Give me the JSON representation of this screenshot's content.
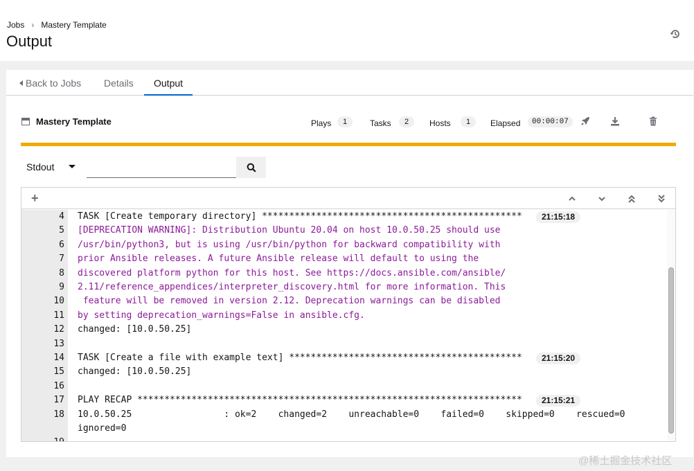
{
  "breadcrumb": {
    "jobs": "Jobs",
    "template": "Mastery Template"
  },
  "page": {
    "title": "Output"
  },
  "tabs": {
    "back": "Back to Jobs",
    "details": "Details",
    "output": "Output"
  },
  "job": {
    "name": "Mastery Template",
    "plays_label": "Plays",
    "plays": "1",
    "tasks_label": "Tasks",
    "tasks": "2",
    "hosts_label": "Hosts",
    "hosts": "1",
    "elapsed_label": "Elapsed",
    "elapsed": "00:00:07"
  },
  "search": {
    "filter_value": "Stdout",
    "placeholder": ""
  },
  "colors": {
    "progress": "#f0ab00",
    "warning_text": "#8c1a9a",
    "active_tab": "#0066cc"
  },
  "icons": [
    "history-icon",
    "rocket-icon",
    "download-icon",
    "trash-icon",
    "search-icon",
    "plus-icon",
    "chevron-up-icon",
    "chevron-down-icon",
    "double-chevron-up-icon",
    "double-chevron-down-icon"
  ],
  "output": {
    "lines": [
      {
        "num": "4",
        "text": "TASK [Create temporary directory] ************************************************",
        "warn": false,
        "ts": "21:15:18"
      },
      {
        "num": "5",
        "text": "[DEPRECATION WARNING]: Distribution Ubuntu 20.04 on host 10.0.50.25 should use",
        "warn": true,
        "ts": ""
      },
      {
        "num": "6",
        "text": "/usr/bin/python3, but is using /usr/bin/python for backward compatibility with",
        "warn": true,
        "ts": ""
      },
      {
        "num": "7",
        "text": "prior Ansible releases. A future Ansible release will default to using the",
        "warn": true,
        "ts": ""
      },
      {
        "num": "8",
        "text": "discovered platform python for this host. See https://docs.ansible.com/ansible/",
        "warn": true,
        "ts": ""
      },
      {
        "num": "9",
        "text": "2.11/reference_appendices/interpreter_discovery.html for more information. This",
        "warn": true,
        "ts": ""
      },
      {
        "num": "10",
        "text": " feature will be removed in version 2.12. Deprecation warnings can be disabled",
        "warn": true,
        "ts": ""
      },
      {
        "num": "11",
        "text": "by setting deprecation_warnings=False in ansible.cfg.",
        "warn": true,
        "ts": ""
      },
      {
        "num": "12",
        "text": "changed: [10.0.50.25]",
        "warn": false,
        "ts": ""
      },
      {
        "num": "13",
        "text": "",
        "warn": false,
        "ts": ""
      },
      {
        "num": "14",
        "text": "TASK [Create a file with example text] *******************************************",
        "warn": false,
        "ts": "21:15:20"
      },
      {
        "num": "15",
        "text": "changed: [10.0.50.25]",
        "warn": false,
        "ts": ""
      },
      {
        "num": "16",
        "text": "",
        "warn": false,
        "ts": ""
      },
      {
        "num": "17",
        "text": "PLAY RECAP ***********************************************************************",
        "warn": false,
        "ts": "21:15:21"
      },
      {
        "num": "18",
        "text": "10.0.50.25                 : ok=2    changed=2    unreachable=0    failed=0    skipped=0    rescued=0",
        "warn": false,
        "ts": ""
      },
      {
        "num": "",
        "text": "ignored=0",
        "warn": false,
        "ts": ""
      },
      {
        "num": "19",
        "text": "",
        "warn": false,
        "ts": ""
      }
    ]
  },
  "watermark": "@稀土掘金技术社区"
}
